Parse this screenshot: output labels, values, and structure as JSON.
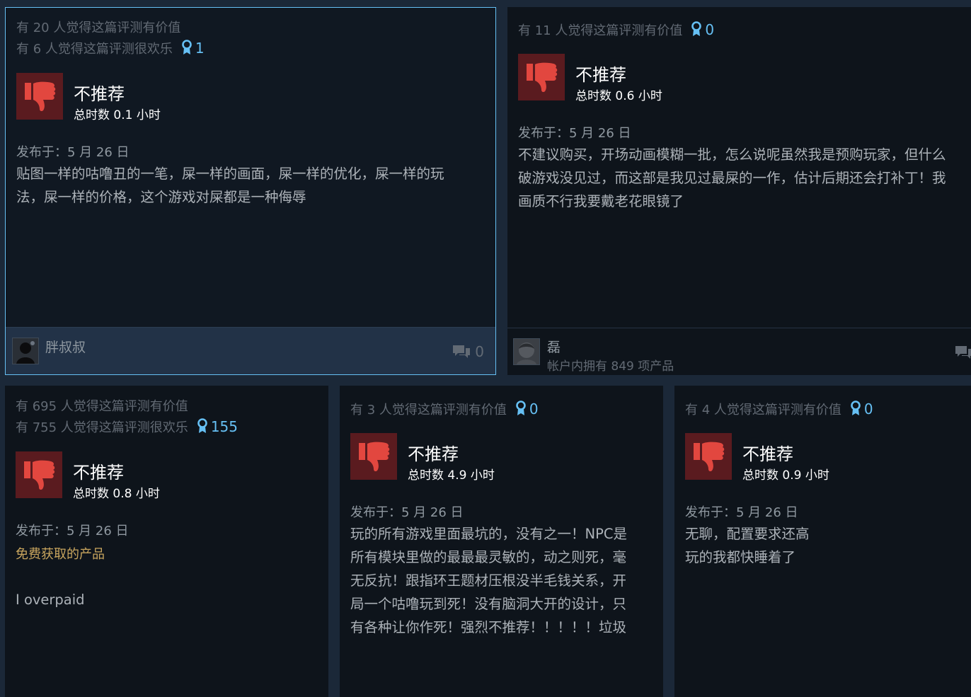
{
  "reviews": [
    {
      "helpful": "有 20 人觉得这篇评测有价值",
      "funny": "有 6 人觉得这篇评测很欢乐",
      "awards": "1",
      "verdict": "不推荐",
      "hours": "总时数 0.1 小时",
      "posted": "发布于：5 月 26 日",
      "body_lines": [
        "贴图一样的咕噜丑的一笔，屎一样的画面，屎一样的优化，屎一样的玩",
        "法，屎一样的价格，这个游戏对屎都是一种侮辱"
      ],
      "author": "胖叔叔",
      "comments": "0"
    },
    {
      "helpful": "有 11 人觉得这篇评测有价值",
      "awards": "0",
      "verdict": "不推荐",
      "hours": "总时数 0.6 小时",
      "posted": "发布于：5 月 26 日",
      "body_lines": [
        "不建议购买，开场动画模糊一批，怎么说呢虽然我是预购玩家，但什么",
        "破游戏没见过，而这部是我见过最屎的一作，估计后期还会打补丁！我",
        "画质不行我要戴老花眼镜了"
      ],
      "author": "磊",
      "products": "帐户内拥有 849 项产品"
    },
    {
      "helpful": "有 695 人觉得这篇评测有价值",
      "funny": "有 755 人觉得这篇评测很欢乐",
      "awards": "155",
      "verdict": "不推荐",
      "hours": "总时数 0.8 小时",
      "posted": "发布于：5 月 26 日",
      "note": "免费获取的产品",
      "body_lines": [
        "I overpaid"
      ]
    },
    {
      "helpful": "有 3 人觉得这篇评测有价值",
      "awards": "0",
      "verdict": "不推荐",
      "hours": "总时数 4.9 小时",
      "posted": "发布于：5 月 26 日",
      "body_lines": [
        "玩的所有游戏里面最坑的，没有之一！NPC是",
        "所有模块里做的最最最灵敏的，动之则死，毫",
        "无反抗！跟指环王题材压根没半毛钱关系，开",
        "局一个咕噜玩到死！没有脑洞大开的设计，只",
        "有各种让你作死！强烈不推荐！！！！！垃圾"
      ]
    },
    {
      "helpful": "有 4 人觉得这篇评测有价值",
      "awards": "0",
      "verdict": "不推荐",
      "hours": "总时数 0.9 小时",
      "posted": "发布于：5 月 26 日",
      "body_lines": [
        "无聊，配置要求还高",
        "玩的我都快睡着了"
      ]
    }
  ],
  "colors": {
    "background": "#1b2838",
    "card": "#0e141b",
    "highlight_border": "#66c0f4",
    "award": "#66c0f4",
    "thumb_bg": "#5a1b1f",
    "thumb_icon": "#e2473f",
    "free_product": "#c8a55e"
  },
  "icons": {
    "thumb": "thumbs-down-icon",
    "award": "award-ribbon-icon",
    "comment": "speech-bubbles-icon"
  }
}
